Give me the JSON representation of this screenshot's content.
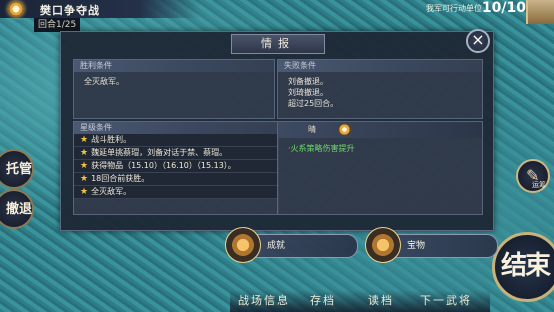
{
  "hud": {
    "battle_title": "樊口争夺战",
    "round": "回合1/25",
    "units_label": "我军可行动单位",
    "units_count": "10/10"
  },
  "side_buttons": {
    "auto": "托管",
    "retreat": "撤退"
  },
  "right_buttons": {
    "status_label": "运筹",
    "end_turn": "结束"
  },
  "bottom_menu": {
    "battle_info": "战场信息",
    "save": "存档",
    "load": "读档",
    "next_general": "下一武将"
  },
  "dialog": {
    "title": "情报",
    "close": "×",
    "win_header": "胜利条件",
    "win_conditions": [
      "全灭敌军。"
    ],
    "lose_header": "失败条件",
    "lose_conditions": [
      "刘备撤退。",
      "刘琦撤退。",
      "超过25回合。"
    ],
    "star_header": "星级条件",
    "star_conditions": [
      "战斗胜利。",
      "魏延单挑蔡瑁，刘备对话于禁、蔡瑁。",
      "获得物品（15.10）（16.10）（15.13）。",
      "18回合前获胜。",
      "全灭敌军。"
    ],
    "weather": "晴",
    "weather_effect": "·火系策略伤害提升"
  },
  "actions": {
    "achievement": "成就",
    "treasure": "宝物"
  },
  "colors": {
    "star": "#f3c43a",
    "effect_green": "#6fd96a",
    "panel_bg": "#1e2634"
  }
}
